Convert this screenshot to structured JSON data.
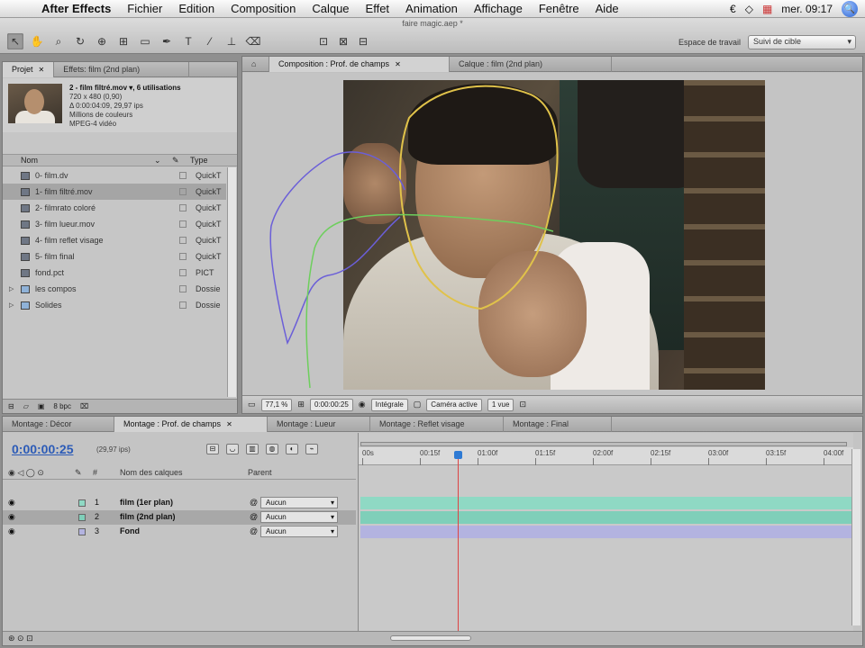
{
  "menubar": {
    "apple": "",
    "items": [
      "After Effects",
      "Fichier",
      "Edition",
      "Composition",
      "Calque",
      "Effet",
      "Animation",
      "Affichage",
      "Fenêtre",
      "Aide"
    ],
    "clock": "mer. 09:17",
    "spotlight": "🔍"
  },
  "toolbar": {
    "doc_title": "faire magic.aep *",
    "workspace_label": "Espace de travail",
    "workspace_value": "Suivi de cible"
  },
  "project": {
    "tabs": [
      "Projet",
      "Effets: film (2nd plan)"
    ],
    "selected": {
      "name": "2 - film filtré.mov ▾, 6 utilisations",
      "size": "720 x 480 (0,90)",
      "duration": "Δ 0:00:04:09, 29,97 ips",
      "colors": "Millions de couleurs",
      "codec": "MPEG-4 vidéo"
    },
    "columns": {
      "name": "Nom",
      "type": "Type"
    },
    "items": [
      {
        "name": "0- film.dv",
        "type": "QuickT",
        "kind": "file"
      },
      {
        "name": "1- film filtré.mov",
        "type": "QuickT",
        "kind": "file",
        "selected": true
      },
      {
        "name": "2- filmrato coloré",
        "type": "QuickT",
        "kind": "file"
      },
      {
        "name": "3- film lueur.mov",
        "type": "QuickT",
        "kind": "file"
      },
      {
        "name": "4- film reflet visage",
        "type": "QuickT",
        "kind": "file"
      },
      {
        "name": "5- film final",
        "type": "QuickT",
        "kind": "file"
      },
      {
        "name": "fond.pct",
        "type": "PICT",
        "kind": "file"
      },
      {
        "name": "les compos",
        "type": "Dossie",
        "kind": "folder"
      },
      {
        "name": "Solides",
        "type": "Dossie",
        "kind": "folder"
      }
    ],
    "bpc": "8 bpc"
  },
  "comp": {
    "tabs": [
      "Composition : Prof. de champs",
      "Calque : film (2nd plan)"
    ],
    "zoom": "77,1 %",
    "timecode": "0:00:00:25",
    "resolution": "Intégrale",
    "camera": "Caméra active",
    "views": "1 vue"
  },
  "timeline": {
    "tabs": [
      "Montage : Décor",
      "Montage : Prof. de champs",
      "Montage : Lueur",
      "Montage : Reflet visage",
      "Montage : Final"
    ],
    "timecode": "0:00:00:25",
    "fps": "(29,97 ips)",
    "col_name": "Nom des calques",
    "col_parent": "Parent",
    "col_num": "#",
    "layers": [
      {
        "index": "1",
        "name": "film (1er plan)",
        "parent": "Aucun",
        "color": "#8fd9c4"
      },
      {
        "index": "2",
        "name": "film (2nd plan)",
        "parent": "Aucun",
        "color": "#7fcfb9",
        "selected": true
      },
      {
        "index": "3",
        "name": "Fond",
        "parent": "Aucun",
        "color": "#b3b3e0"
      }
    ],
    "ruler": [
      "00s",
      "00:15f",
      "01:00f",
      "01:15f",
      "02:00f",
      "02:15f",
      "03:00f",
      "03:15f",
      "04:00f"
    ]
  },
  "colors": {
    "mask_face": "#e0c24a",
    "mask_blue": "#6b5fd8",
    "mask_green": "#6dcf5c",
    "cti": "#dd4444",
    "timecode": "#2c5bb7"
  }
}
